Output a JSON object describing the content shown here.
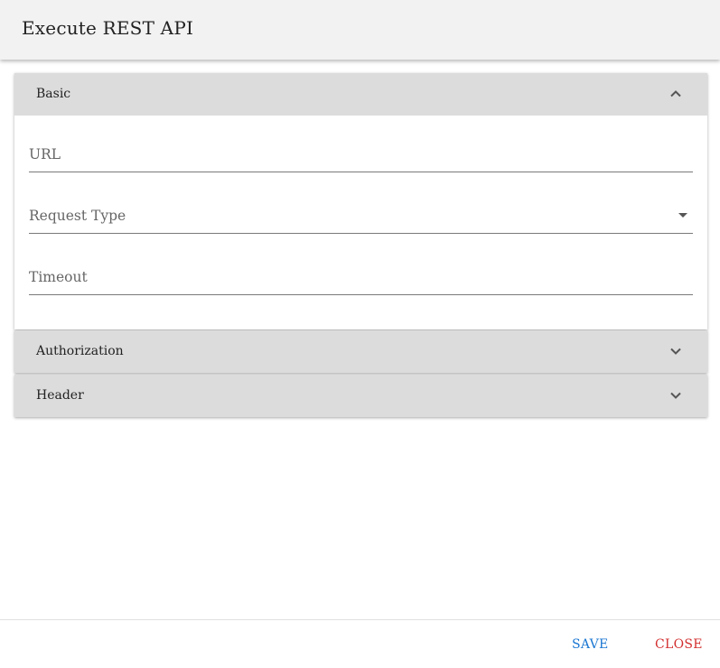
{
  "dialog": {
    "title": "Execute REST API"
  },
  "panels": {
    "basic": {
      "label": "Basic",
      "expanded": true,
      "fields": {
        "url": {
          "label": "URL",
          "value": ""
        },
        "request_type": {
          "label": "Request Type",
          "value": ""
        },
        "timeout": {
          "label": "Timeout",
          "value": ""
        }
      }
    },
    "authorization": {
      "label": "Authorization",
      "expanded": false
    },
    "header": {
      "label": "Header",
      "expanded": false
    }
  },
  "footer": {
    "save_label": "SAVE",
    "close_label": "CLOSE"
  },
  "icons": {
    "expand_less": "chevron-up-icon",
    "expand_more": "chevron-down-icon",
    "dropdown": "caret-down-icon"
  },
  "colors": {
    "save": "#1976d2",
    "close": "#d32f2f",
    "panel_header_bg": "#dcdcdc",
    "dialog_header_bg": "#f2f2f2"
  }
}
